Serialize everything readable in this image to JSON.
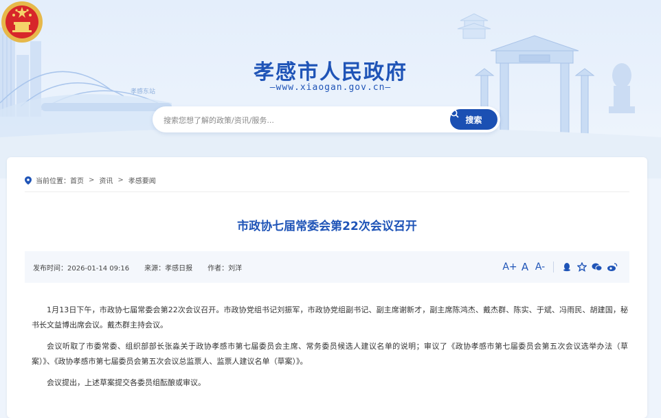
{
  "header": {
    "site_title": "孝感市人民政府",
    "site_domain": "—www.xiaogan.gov.cn—",
    "station_sign": "孝感东站"
  },
  "search": {
    "placeholder": "搜索您想了解的政策/资讯/服务...",
    "button_label": "搜索"
  },
  "breadcrumb": {
    "prefix": "当前位置：",
    "items": [
      "首页",
      "资讯",
      "孝感要闻"
    ],
    "separator": ">"
  },
  "article": {
    "title": "市政协七届常委会第22次会议召开",
    "publish_time": "发布时间：2026-01-14 09:16",
    "source": "来源：孝感日报",
    "author": "作者：刘洋",
    "paragraphs": [
      "1月13日下午，市政协七届常委会第22次会议召开。市政协党组书记刘振军，市政协党组副书记、副主席谢新才，副主席陈鸿杰、戴杰群、陈实、于斌、冯雨民、胡建国，秘书长文益博出席会议。戴杰群主持会议。",
      "会议听取了市委常委、组织部部长张淼关于政协孝感市第七届委员会主席、常务委员候选人建议名单的说明；审议了《政协孝感市第七届委员会第五次会议选举办法（草案）》、《政协孝感市第七届委员会第五次会议总监票人、监票人建议名单（草案）》。",
      "会议提出，上述草案提交各委员组酝酿或审议。"
    ]
  },
  "tools": {
    "font_larger": "A+",
    "font_normal": "A",
    "font_smaller": "A-"
  },
  "colors": {
    "brand_blue": "#1f54b7",
    "button_blue": "#1b50b3",
    "meta_bg": "#f4f7fc"
  }
}
